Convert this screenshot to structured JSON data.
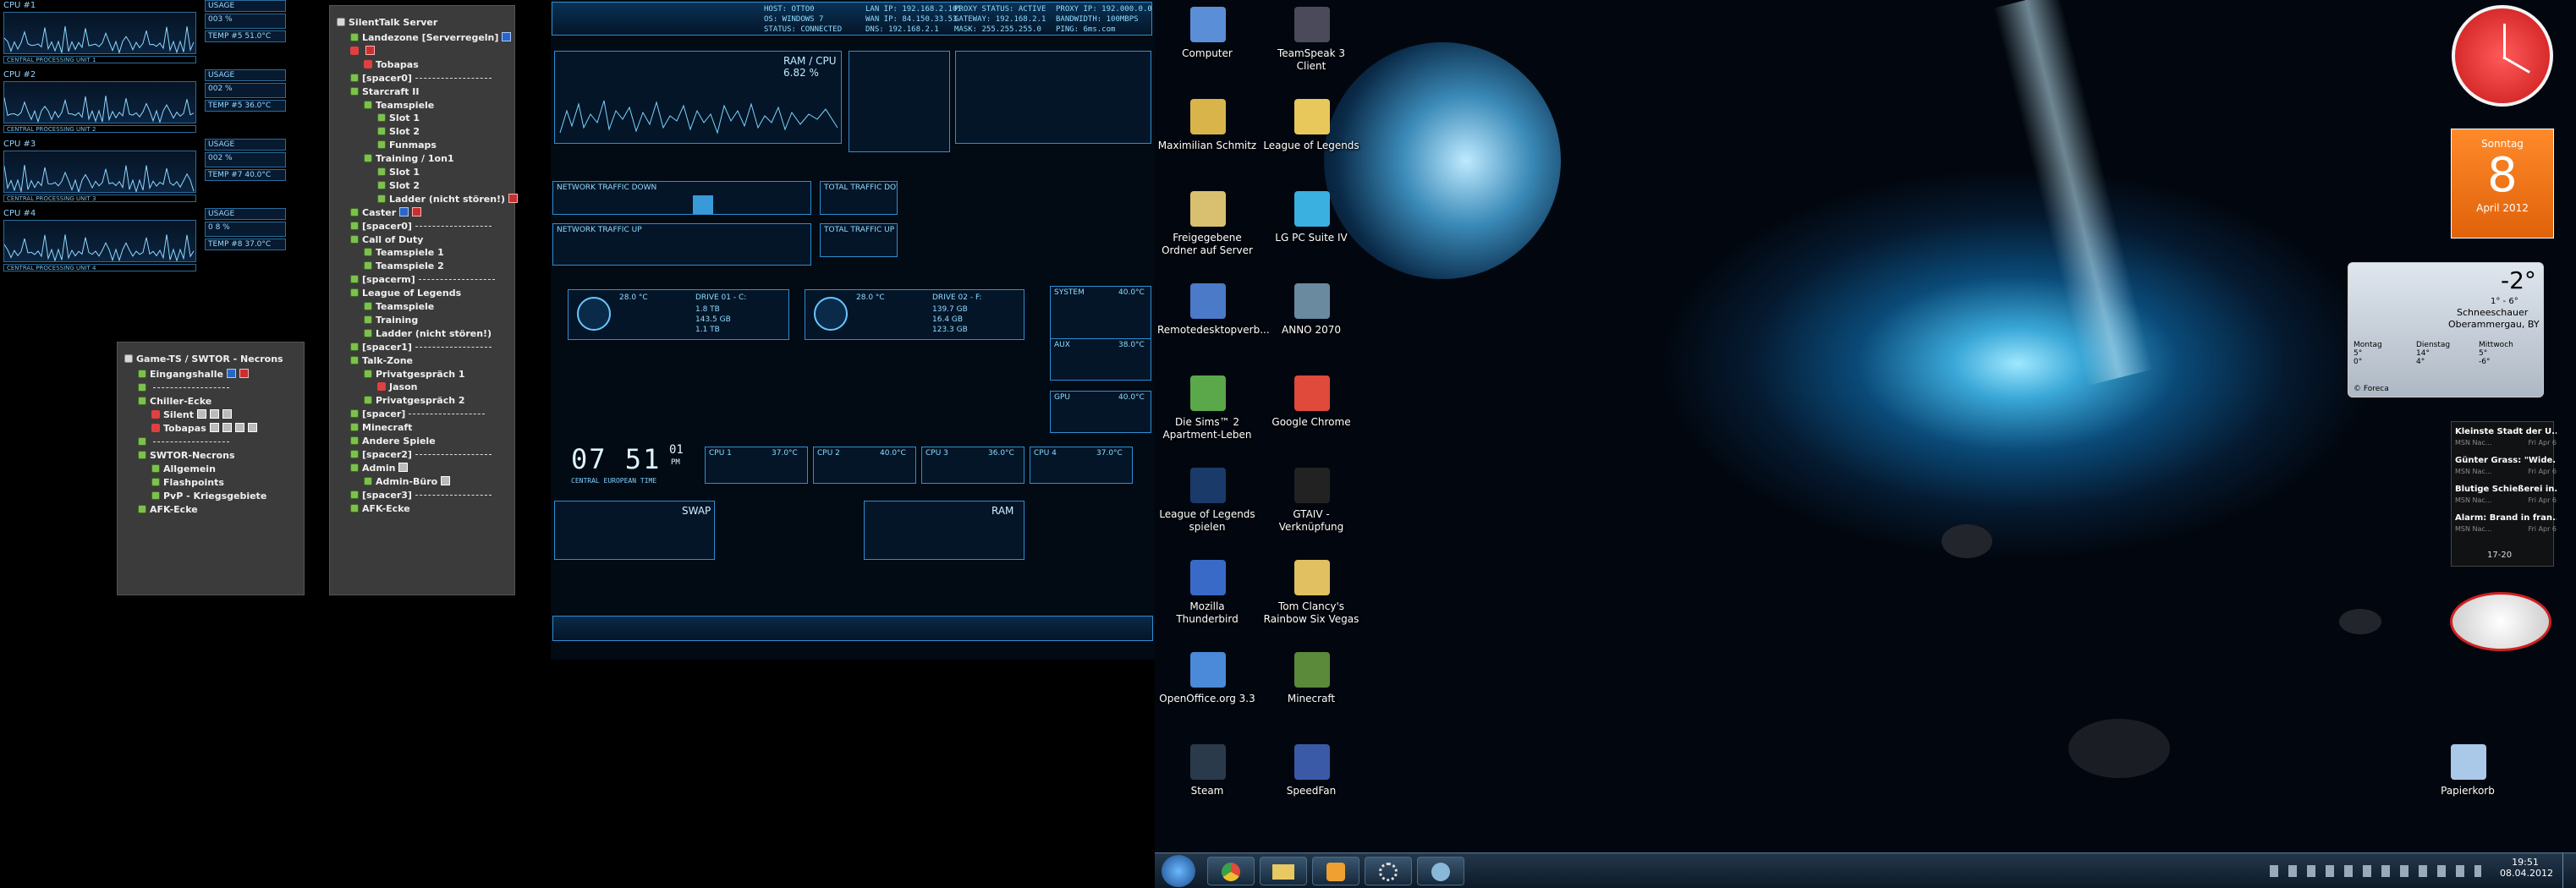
{
  "cpu_panels": [
    {
      "label": "CPU #1",
      "usage_title": "USAGE",
      "usage": "003 %",
      "temp": "TEMP #5  51.0°C",
      "bar": "CENTRAL PROCESSING UNIT 1"
    },
    {
      "label": "CPU #2",
      "usage_title": "USAGE",
      "usage": "002 %",
      "temp": "TEMP #5  36.0°C",
      "bar": "CENTRAL PROCESSING UNIT 2"
    },
    {
      "label": "CPU #3",
      "usage_title": "USAGE",
      "usage": "002 %",
      "temp": "TEMP #7  40.0°C",
      "bar": "CENTRAL PROCESSING UNIT 3"
    },
    {
      "label": "CPU #4",
      "usage_title": "USAGE",
      "usage": "0 8 %",
      "temp": "TEMP #8  37.0°C",
      "bar": "CENTRAL PROCESSING UNIT 4"
    }
  ],
  "ts_left": {
    "server": "Game-TS / SWTOR - Necrons",
    "rows": [
      {
        "t": "Eingangshalle",
        "lv": 1,
        "k": "ch",
        "f": [
          "b",
          "r"
        ]
      },
      {
        "t": "",
        "lv": 1,
        "k": "spc",
        "dash": true
      },
      {
        "t": "Chiller-Ecke",
        "lv": 1,
        "k": "ch"
      },
      {
        "t": "Silent",
        "lv": 2,
        "k": "usr",
        "f": [
          "g",
          "g",
          "g"
        ]
      },
      {
        "t": "Tobapas",
        "lv": 2,
        "k": "usr",
        "f": [
          "g",
          "g",
          "g",
          "g"
        ]
      },
      {
        "t": "",
        "lv": 1,
        "k": "spc",
        "dash": true
      },
      {
        "t": "SWTOR-Necrons",
        "lv": 1,
        "k": "ch"
      },
      {
        "t": "Allgemein",
        "lv": 2,
        "k": "ch"
      },
      {
        "t": "Flashpoints",
        "lv": 2,
        "k": "ch"
      },
      {
        "t": "PvP - Kriegsgebiete",
        "lv": 2,
        "k": "ch"
      },
      {
        "t": "AFK-Ecke",
        "lv": 1,
        "k": "ch"
      }
    ]
  },
  "ts_right": {
    "server": "SilentTalk Server",
    "rows": [
      {
        "t": "Landezone [Serverregeln]",
        "lv": 1,
        "k": "ch",
        "f": [
          "b"
        ]
      },
      {
        "t": "",
        "lv": 1,
        "k": "usr",
        "f": [
          "r"
        ]
      },
      {
        "t": "Tobapas",
        "lv": 2,
        "k": "usr"
      },
      {
        "t": "[spacer0]",
        "lv": 1,
        "k": "spc",
        "dash": true
      },
      {
        "t": "Starcraft II",
        "lv": 1,
        "k": "ch"
      },
      {
        "t": "Teamspiele",
        "lv": 2,
        "k": "ch"
      },
      {
        "t": "Slot 1",
        "lv": 3,
        "k": "ch"
      },
      {
        "t": "Slot 2",
        "lv": 3,
        "k": "ch"
      },
      {
        "t": "Funmaps",
        "lv": 3,
        "k": "ch"
      },
      {
        "t": "Training / 1on1",
        "lv": 2,
        "k": "ch"
      },
      {
        "t": "Slot 1",
        "lv": 3,
        "k": "ch"
      },
      {
        "t": "Slot 2",
        "lv": 3,
        "k": "ch"
      },
      {
        "t": "Ladder (nicht stören!)",
        "lv": 3,
        "k": "ch",
        "f": [
          "r"
        ]
      },
      {
        "t": "Caster",
        "lv": 1,
        "k": "ch",
        "f": [
          "b",
          "r"
        ]
      },
      {
        "t": "[spacer0]",
        "lv": 1,
        "k": "spc",
        "dash": true
      },
      {
        "t": "Call of Duty",
        "lv": 1,
        "k": "ch"
      },
      {
        "t": "Teamspiele 1",
        "lv": 2,
        "k": "ch"
      },
      {
        "t": "Teamspiele 2",
        "lv": 2,
        "k": "ch"
      },
      {
        "t": "[spacerm]",
        "lv": 1,
        "k": "spc",
        "dash": true
      },
      {
        "t": "League of Legends",
        "lv": 1,
        "k": "ch"
      },
      {
        "t": "Teamspiele",
        "lv": 2,
        "k": "ch"
      },
      {
        "t": "Training",
        "lv": 2,
        "k": "ch"
      },
      {
        "t": "Ladder (nicht stören!)",
        "lv": 2,
        "k": "ch"
      },
      {
        "t": "[spacer1]",
        "lv": 1,
        "k": "spc",
        "dash": true
      },
      {
        "t": "Talk-Zone",
        "lv": 1,
        "k": "ch"
      },
      {
        "t": "Privatgespräch 1",
        "lv": 2,
        "k": "ch"
      },
      {
        "t": "Jason",
        "lv": 3,
        "k": "usr"
      },
      {
        "t": "Privatgespräch 2",
        "lv": 2,
        "k": "ch"
      },
      {
        "t": "[spacer]",
        "lv": 1,
        "k": "spc",
        "dash": true
      },
      {
        "t": "Minecraft",
        "lv": 1,
        "k": "ch"
      },
      {
        "t": "Andere Spiele",
        "lv": 1,
        "k": "ch"
      },
      {
        "t": "[spacer2]",
        "lv": 1,
        "k": "spc",
        "dash": true
      },
      {
        "t": "Admin",
        "lv": 1,
        "k": "ch",
        "f": [
          "g"
        ]
      },
      {
        "t": "Admin-Büro",
        "lv": 2,
        "k": "ch",
        "f": [
          "g"
        ]
      },
      {
        "t": "[spacer3]",
        "lv": 1,
        "k": "spc",
        "dash": true
      },
      {
        "t": "AFK-Ecke",
        "lv": 1,
        "k": "ch"
      }
    ]
  },
  "hud": {
    "header": {
      "host": "HOST: OTTO0",
      "os": "OS: WINDOWS 7",
      "status": "STATUS: CONNECTED",
      "lan_ip": "LAN IP: 192.168.2.101",
      "wan_ip": "WAN IP: 84.150.33.53",
      "dns": "DNS: 192.168.2.1",
      "proxy": "PROXY STATUS: ACTIVE",
      "gateway": "GATEWAY: 192.168.2.1",
      "mask": "MASK: 255.255.255.0",
      "proxy_ip": "PROXY IP: 192.000.0.0",
      "bandwidth": "BANDWIDTH: 100MBPS",
      "ping": "PING: 6ms.com"
    },
    "ram_title": "RAM / CPU",
    "ram_val": "6.82 %",
    "net_down": "NETWORK TRAFFIC DOWN",
    "net_up": "NETWORK TRAFFIC UP",
    "total_down": "TOTAL TRAFFIC DOWN",
    "total_up": "TOTAL TRAFFIC UP",
    "drive1": {
      "temp": "28.0 °C",
      "name": "DRIVE 01 - C:",
      "total": "1.8 TB",
      "used": "143.5 GB",
      "free": "1.1 TB"
    },
    "drive2": {
      "temp": "28.0 °C",
      "name": "DRIVE 02 - F:",
      "total": "139.7 GB",
      "used": "16.4 GB",
      "free": "123.3 GB"
    },
    "system": "SYSTEM",
    "system_val": "40.0°C",
    "aux": "AUX",
    "aux_val": "38.0°C",
    "gpu": "GPU",
    "gpu_val": "40.0°C",
    "clock": "07 51",
    "clock_sec": "01",
    "clock_ampm": "PM",
    "clock_tz": "CENTRAL EUROPEAN TIME",
    "cpu_cells": [
      {
        "l": "CPU 1",
        "v": "37.0°C"
      },
      {
        "l": "CPU 2",
        "v": "40.0°C"
      },
      {
        "l": "CPU 3",
        "v": "36.0°C"
      },
      {
        "l": "CPU 4",
        "v": "37.0°C"
      }
    ],
    "swap": "SWAP",
    "ram": "RAM"
  },
  "desktop_icons": [
    {
      "name": "Computer",
      "color": "#5a8fd8"
    },
    {
      "name": "TeamSpeak 3 Client",
      "color": "#4a4a5a"
    },
    {
      "name": "Maximilian Schmitz",
      "color": "#d8b44a"
    },
    {
      "name": "League of Legends",
      "color": "#e8c85a"
    },
    {
      "name": "Freigegebene Ordner auf Server",
      "color": "#d8c070"
    },
    {
      "name": "LG PC Suite IV",
      "color": "#3ab0e0"
    },
    {
      "name": "Remotedesktopverb...",
      "color": "#4a7ac8"
    },
    {
      "name": "ANNO 2070",
      "color": "#6a8aa0"
    },
    {
      "name": "Die Sims™ 2 Apartment-Leben",
      "color": "#5aa84a"
    },
    {
      "name": "Google Chrome",
      "color": "#e04a3a"
    },
    {
      "name": "League of Legends spielen",
      "color": "#1a3a6a"
    },
    {
      "name": "GTAIV - Verknüpfung",
      "color": "#222"
    },
    {
      "name": "Mozilla Thunderbird",
      "color": "#3a6ac8"
    },
    {
      "name": "Tom Clancy's Rainbow Six Vegas",
      "color": "#e0c060"
    },
    {
      "name": "OpenOffice.org 3.3",
      "color": "#4a8ad8"
    },
    {
      "name": "Minecraft",
      "color": "#5a8a3a"
    },
    {
      "name": "Steam",
      "color": "#2a3a4a"
    },
    {
      "name": "SpeedFan",
      "color": "#3a5aa8"
    },
    {
      "name": "Papierkorb",
      "color": "#aac8e8"
    }
  ],
  "calendar": {
    "weekday": "Sonntag",
    "day": "8",
    "month": "April 2012"
  },
  "weather": {
    "temp": "-2°",
    "range": "1° - 6°",
    "cond": "Schneeschauer",
    "place": "Oberammergau, BY",
    "days": [
      {
        "d": "Montag",
        "hi": "5°",
        "lo": "0°"
      },
      {
        "d": "Dienstag",
        "hi": "14°",
        "lo": "4°"
      },
      {
        "d": "Mittwoch",
        "hi": "5°",
        "lo": "-6°"
      }
    ],
    "src": "© Foreca"
  },
  "news": {
    "items": [
      {
        "h": "Kleinste Stadt der U...",
        "s": "MSN Nac...",
        "d": "Fri Apr 6"
      },
      {
        "h": "Günter Grass: \"Wide...",
        "s": "MSN Nac...",
        "d": "Fri Apr 6"
      },
      {
        "h": "Blutige Schießerei in...",
        "s": "MSN Nac...",
        "d": "Fri Apr 6"
      },
      {
        "h": "Alarm: Brand in fran...",
        "s": "MSN Nac...",
        "d": "Fri Apr 6"
      }
    ],
    "pager": "17-20"
  },
  "taskbar": {
    "time": "19:51",
    "date": "08.04.2012"
  }
}
